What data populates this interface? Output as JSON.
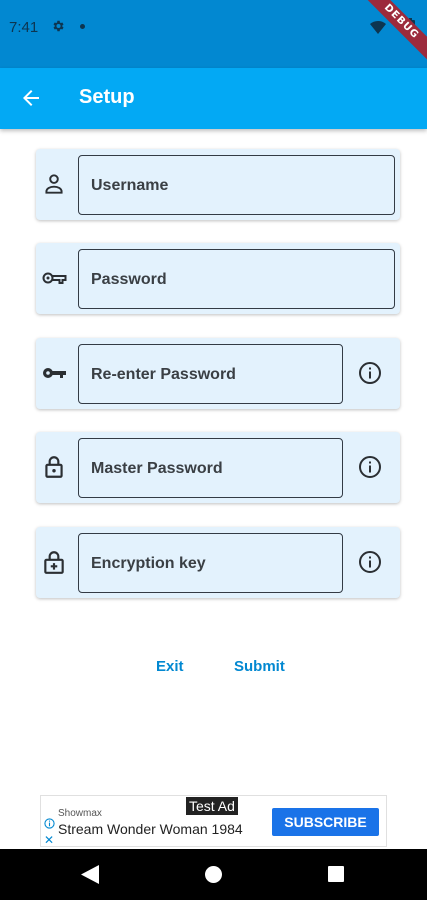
{
  "status_bar": {
    "time": "7:41",
    "debug_banner": "DEBUG"
  },
  "app_bar": {
    "title": "Setup"
  },
  "fields": [
    {
      "label": "Username",
      "icon": "person-icon",
      "has_info": false
    },
    {
      "label": "Password",
      "icon": "key-outline-icon",
      "has_info": false
    },
    {
      "label": "Re-enter Password",
      "icon": "key-icon",
      "has_info": true
    },
    {
      "label": "Master Password",
      "icon": "lock-icon",
      "has_info": true
    },
    {
      "label": "Encryption key",
      "icon": "lock-plus-icon",
      "has_info": true
    }
  ],
  "buttons": {
    "exit": "Exit",
    "submit": "Submit"
  },
  "ad": {
    "tag": "Test Ad",
    "advertiser": "Showmax",
    "headline": "Stream Wonder Woman 1984",
    "cta": "SUBSCRIBE",
    "close": "✕"
  },
  "colors": {
    "status_bar": "#0288d1",
    "app_bar": "#03a9f4",
    "card_bg": "#e3f2fd",
    "button_text": "#0288d1"
  }
}
